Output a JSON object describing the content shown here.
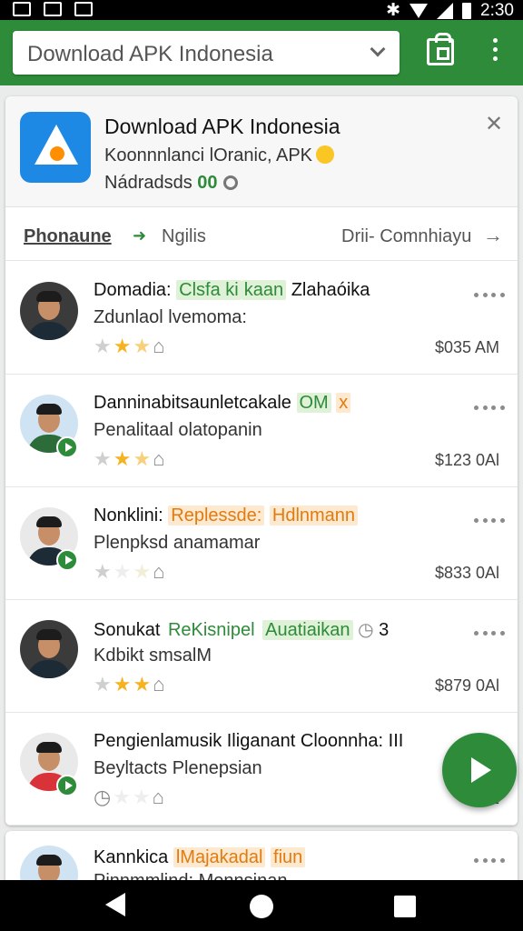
{
  "status_bar": {
    "time": "2:30"
  },
  "search": {
    "value": "Download APK Indonesia"
  },
  "app": {
    "title": "Download APK Indonesia",
    "subtitle": "Koonnnlanci lOranic, APK",
    "meta_label": "Nádradsds",
    "meta_value": "00"
  },
  "tabs": {
    "tab1": "Phonaune",
    "tab2": "Ngilis",
    "tab3": "Drii- Comnhiayu"
  },
  "rows": [
    {
      "title": "Domadia:",
      "tag": "Clsfa ki",
      "tag2": "kaan",
      "rest": "Zlahaóika",
      "sub": "Zdunlaol lvemoma:",
      "price": "$035 AM",
      "stars": "2.5"
    },
    {
      "title": "Danninabitsaunletcakale",
      "tag": "OM",
      "tag2": "x",
      "rest": "",
      "sub": "Penalitaal olatopanin",
      "price": "$123 0Al",
      "stars": "2.5"
    },
    {
      "title": "Nonklini:",
      "tag": "Replessde:",
      "tag2": "Hdlnmann",
      "rest": "",
      "sub": "Plenpksd anamamar",
      "price": "$833 0Al",
      "stars": "1"
    },
    {
      "title": "Sonukat",
      "tag": "ReKisnipel",
      "tag2": "Auatiaikan",
      "rest": "3",
      "sub": "Kdbikt smsalM",
      "price": "$879 0Al",
      "stars": "3"
    },
    {
      "title": "Pengienlamusik Iliganant Cloonnha:",
      "tag": "",
      "tag2": "",
      "rest": "III",
      "sub": "Beyltacts Plenepsian",
      "price": "$2",
      "stars": "0"
    },
    {
      "title": "Kannkica",
      "tag": "lMajakadal",
      "tag2": "fiun",
      "rest": "",
      "sub": "Pinnmmlind: Mennsinan",
      "price": "",
      "stars": ""
    }
  ]
}
